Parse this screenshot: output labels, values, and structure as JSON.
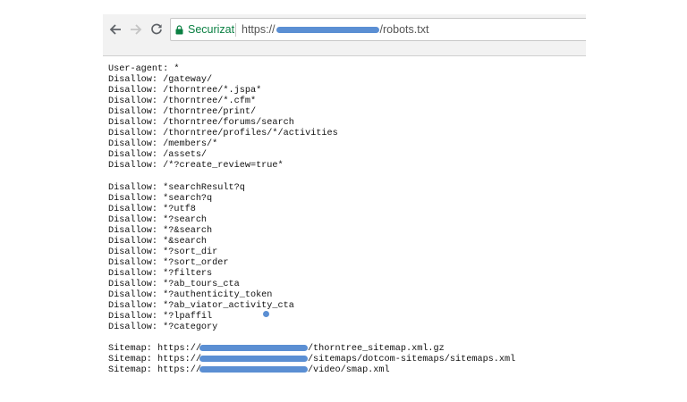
{
  "toolbar": {
    "secure_label": "Securizat",
    "url_scheme": "https://",
    "url_path": "/robots.txt"
  },
  "robots": {
    "group1": [
      "User-agent: *",
      "Disallow: /gateway/",
      "Disallow: /thorntree/*.jspa*",
      "Disallow: /thorntree/*.cfm*",
      "Disallow: /thorntree/print/",
      "Disallow: /thorntree/forums/search",
      "Disallow: /thorntree/profiles/*/activities",
      "Disallow: /members/*",
      "Disallow: /assets/",
      "Disallow: /*?create_review=true*"
    ],
    "group2": [
      "Disallow: *searchResult?q",
      "Disallow: *search?q",
      "Disallow: *?utf8",
      "Disallow: *?search",
      "Disallow: *?&search",
      "Disallow: *&search",
      "Disallow: *?sort_dir",
      "Disallow: *?sort_order",
      "Disallow: *?filters",
      "Disallow: *?ab_tours_cta",
      "Disallow: *?authenticity_token",
      "Disallow: *?ab_viator_activity_cta",
      "Disallow: *?lpaffil",
      "Disallow: *?category"
    ],
    "sitemaps": [
      {
        "prefix": "Sitemap: https://",
        "path": "/thorntree_sitemap.xml.gz"
      },
      {
        "prefix": "Sitemap: https://",
        "path": "/sitemaps/dotcom-sitemaps/sitemaps.xml"
      },
      {
        "prefix": "Sitemap: https://",
        "path": "/video/smap.xml"
      }
    ]
  },
  "colors": {
    "secure_green": "#0b8043",
    "redaction_blue": "#5b8fd3"
  }
}
